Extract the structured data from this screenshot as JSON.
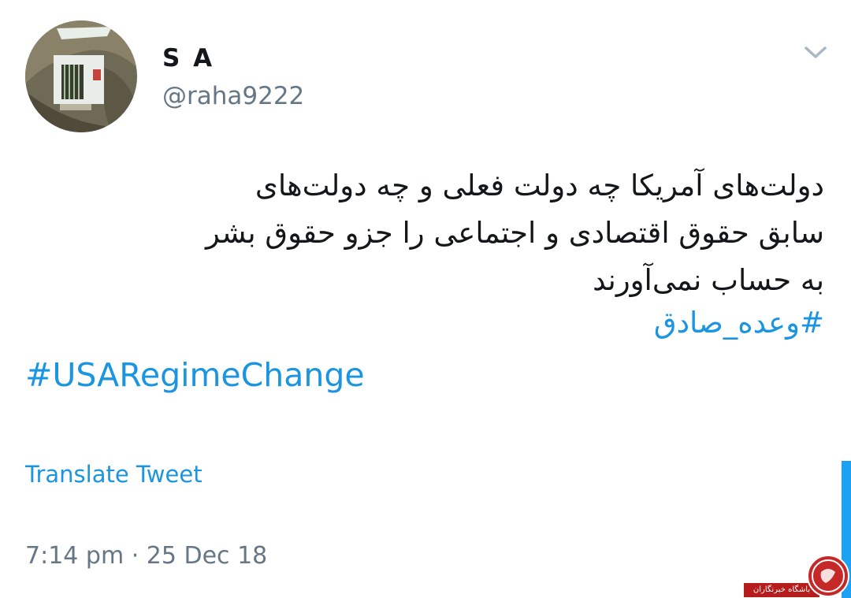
{
  "user": {
    "display_name": "S A",
    "handle": "@raha9222"
  },
  "tweet": {
    "text_lines": [
      "دولت‌های آمریکا چه دولت فعلی و چه دولت‌های",
      "سابق حقوق اقتصادی و اجتماعی را جزو حقوق بشر",
      "به حساب نمی‌آورند"
    ],
    "hashtag_fa": "#وعده_صادق",
    "hashtag_en": "#USARegimeChange",
    "translate_label": "Translate Tweet",
    "timestamp": "7:14 pm · 25 Dec 18"
  },
  "watermark": {
    "text": "باشگاه خبرنگاران"
  },
  "icons": {
    "menu": "chevron-down-icon",
    "avatar": "profile-photo",
    "watermark": "news-agency-logo"
  },
  "colors": {
    "link": "#1b95e0",
    "primary_text": "#14171a",
    "secondary_text": "#657786",
    "scrollbar": "#1da1f2",
    "watermark_red": "#b71c1c"
  }
}
